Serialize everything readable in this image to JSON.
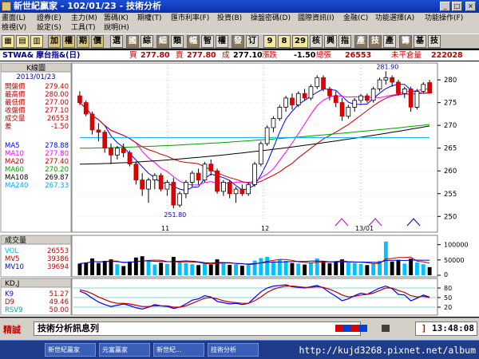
{
  "window": {
    "title": "新世紀贏家 - 102/01/23 - 技術分析"
  },
  "menu": {
    "row1": [
      "畫面(L)",
      "證券(E)",
      "主力(M)",
      "籌碼(K)",
      "期權(T)",
      "匯市利率(F)",
      "投資(B)",
      "操盤密碼(D)",
      "國際資訊(I)",
      "金融(C)",
      "功能選擇(A)",
      "功能操作(F)"
    ],
    "row2": [
      "檢視(V)",
      "設定(S)",
      "工具(T)",
      "說明(H)"
    ]
  },
  "toolbar": {
    "buttons": [
      "加",
      "權",
      "期",
      "價",
      "選",
      "國",
      "綜",
      "細",
      "類",
      "幅",
      "智",
      "權",
      "發",
      "订",
      "9",
      "8",
      "29",
      "核",
      "興",
      "指",
      "產",
      "技",
      "產",
      "籌",
      "基",
      "技"
    ]
  },
  "quote": {
    "symbol": "STWA& 摩台指&(日)",
    "buy_label": "買",
    "buy": "277.80",
    "sell_label": "賣",
    "sell": "277.80",
    "deal_label": "成",
    "deal": "277.10",
    "change_label": "漲跌",
    "change": "-1.50",
    "volume_label": "總張",
    "volume": "26553",
    "oi_label": "未平倉量",
    "oi": "222028"
  },
  "legend_panel": {
    "header": "K線圖",
    "date": "2013/01/23",
    "ohlc": [
      {
        "label": "開盤價",
        "value": "279.40"
      },
      {
        "label": "最高價",
        "value": "280.00"
      },
      {
        "label": "最低價",
        "value": "277.00"
      },
      {
        "label": "收盤價",
        "value": "277.10"
      },
      {
        "label": "成交量",
        "value": "26553"
      },
      {
        "label": "差",
        "value": "-1.50"
      }
    ],
    "ma": [
      {
        "label": "MA5",
        "value": "278.88",
        "color": "#0000ff"
      },
      {
        "label": "MA10",
        "value": "277.80",
        "color": "#ff00ff"
      },
      {
        "label": "MA20",
        "value": "277.40",
        "color": "#c00000"
      },
      {
        "label": "MA60",
        "value": "270.20",
        "color": "#00a000"
      },
      {
        "label": "MA108",
        "value": "269.87",
        "color": "#000000"
      },
      {
        "label": "MA240",
        "value": "267.33",
        "color": "#00aaff"
      }
    ]
  },
  "volume_panel": {
    "header": "成交量",
    "items": [
      {
        "label": "VOL",
        "value": "26553",
        "color": "#00c0ff"
      },
      {
        "label": "MV5",
        "value": "39386",
        "color": "#c00000"
      },
      {
        "label": "MV10",
        "value": "39694",
        "color": "#0000c0"
      }
    ],
    "axis": [
      "100000",
      "50000",
      "0"
    ]
  },
  "kd_panel": {
    "header": "KD,J",
    "items": [
      {
        "label": "K9",
        "value": "51.27",
        "color": "#0000ff"
      },
      {
        "label": "D9",
        "value": "49.46",
        "color": "#c00000"
      },
      {
        "label": "RSV9",
        "value": "50.00",
        "color": "#00a0a0"
      }
    ],
    "axis": [
      "80",
      "50",
      "20"
    ]
  },
  "price_axis": [
    "280",
    "275",
    "270",
    "265",
    "260",
    "255",
    "250"
  ],
  "annotations": {
    "high": "281.90",
    "low": "251.80"
  },
  "date_labels": [
    "11",
    "12",
    "13/01"
  ],
  "status": {
    "badge": "精誠",
    "message": "技術分析訊息列",
    "clock": "13:48:08"
  },
  "taskbar": {
    "tasks": [
      "新世紀贏家",
      "元富贏家",
      "新世紀...",
      "技術分析"
    ],
    "url": "http://kujd3268.pixnet.net/album"
  },
  "chart_data": [
    {
      "type": "candlestick",
      "title": "STWA& 摩台指&(日)",
      "x_ticks": [
        "11",
        "12",
        "13/01"
      ],
      "ylim": [
        249,
        283
      ],
      "annotations": {
        "high": 281.9,
        "low": 251.8
      },
      "candles": [
        [
          276.5,
          277.5,
          274.5,
          275.0
        ],
        [
          275.0,
          275.5,
          272.0,
          272.5
        ],
        [
          272.5,
          273.0,
          268.0,
          269.0
        ],
        [
          269.0,
          270.5,
          266.5,
          268.5
        ],
        [
          268.5,
          269.0,
          264.0,
          265.0
        ],
        [
          265.0,
          266.0,
          261.5,
          263.5
        ],
        [
          263.5,
          265.5,
          262.5,
          265.0
        ],
        [
          265.0,
          266.0,
          263.0,
          264.0
        ],
        [
          264.0,
          264.5,
          261.0,
          261.5
        ],
        [
          261.5,
          262.0,
          257.0,
          258.0
        ],
        [
          258.0,
          259.5,
          254.5,
          256.0
        ],
        [
          256.0,
          258.5,
          253.0,
          258.0
        ],
        [
          258.0,
          259.5,
          256.0,
          259.0
        ],
        [
          259.0,
          259.5,
          255.5,
          256.0
        ],
        [
          256.0,
          258.0,
          254.5,
          257.5
        ],
        [
          257.5,
          258.5,
          251.8,
          252.5
        ],
        [
          252.5,
          255.5,
          252.0,
          255.0
        ],
        [
          255.0,
          258.0,
          254.0,
          257.5
        ],
        [
          257.5,
          260.0,
          256.5,
          259.5
        ],
        [
          259.5,
          260.5,
          257.0,
          258.0
        ],
        [
          258.0,
          262.0,
          257.5,
          261.5
        ],
        [
          261.5,
          262.5,
          259.0,
          260.0
        ],
        [
          260.0,
          260.5,
          255.0,
          255.5
        ],
        [
          255.5,
          258.0,
          254.5,
          257.5
        ],
        [
          257.5,
          258.0,
          254.0,
          255.0
        ],
        [
          255.0,
          256.5,
          253.0,
          256.0
        ],
        [
          256.0,
          257.0,
          254.5,
          255.0
        ],
        [
          255.0,
          257.5,
          254.5,
          257.0
        ],
        [
          257.0,
          262.0,
          256.5,
          261.5
        ],
        [
          261.5,
          266.5,
          261.0,
          266.0
        ],
        [
          266.0,
          270.0,
          265.5,
          269.5
        ],
        [
          269.5,
          272.0,
          268.5,
          271.5
        ],
        [
          271.5,
          274.5,
          271.0,
          274.0
        ],
        [
          274.0,
          276.5,
          273.0,
          276.0
        ],
        [
          276.0,
          277.0,
          273.5,
          274.5
        ],
        [
          274.5,
          277.5,
          274.0,
          277.0
        ],
        [
          277.0,
          278.0,
          275.5,
          276.0
        ],
        [
          276.0,
          279.0,
          275.5,
          278.5
        ],
        [
          278.5,
          281.0,
          278.0,
          280.5
        ],
        [
          280.5,
          281.0,
          277.5,
          278.0
        ],
        [
          278.0,
          278.5,
          275.5,
          276.5
        ],
        [
          276.5,
          277.5,
          274.0,
          275.0
        ],
        [
          275.0,
          276.0,
          271.0,
          272.0
        ],
        [
          272.0,
          274.5,
          271.5,
          274.0
        ],
        [
          274.0,
          276.0,
          273.0,
          275.5
        ],
        [
          275.5,
          277.0,
          274.5,
          276.5
        ],
        [
          276.5,
          277.0,
          275.0,
          275.5
        ],
        [
          275.5,
          278.5,
          275.0,
          278.0
        ],
        [
          278.0,
          280.5,
          277.5,
          280.0
        ],
        [
          280.0,
          281.9,
          279.0,
          280.5
        ],
        [
          280.5,
          281.0,
          278.5,
          279.5
        ],
        [
          279.5,
          280.0,
          276.5,
          277.0
        ],
        [
          277.0,
          278.5,
          276.0,
          278.0
        ],
        [
          278.0,
          278.5,
          273.0,
          274.0
        ],
        [
          274.0,
          278.0,
          273.5,
          277.5
        ],
        [
          277.5,
          279.5,
          277.0,
          279.0
        ],
        [
          279.4,
          280.0,
          277.0,
          277.1
        ]
      ]
    },
    {
      "type": "bar",
      "title": "成交量",
      "ylim": [
        0,
        120000
      ],
      "values": [
        38000,
        42000,
        55000,
        40000,
        47000,
        52000,
        36000,
        30000,
        45000,
        58000,
        62000,
        48000,
        35000,
        41000,
        37000,
        60000,
        44000,
        39000,
        36000,
        33000,
        40000,
        35000,
        52000,
        38000,
        34000,
        36000,
        31000,
        33000,
        48000,
        56000,
        60000,
        45000,
        50000,
        47000,
        40000,
        38000,
        35000,
        42000,
        55000,
        46000,
        39000,
        44000,
        52000,
        41000,
        40000,
        37000,
        33000,
        39000,
        47000,
        110000,
        45000,
        50000,
        38000,
        54000,
        42000,
        36000,
        26553
      ]
    },
    {
      "type": "line",
      "title": "KD,J",
      "ylim": [
        0,
        100
      ],
      "series": [
        {
          "name": "K9",
          "values": [
            70,
            62,
            48,
            36,
            28,
            22,
            26,
            30,
            25,
            18,
            14,
            20,
            28,
            24,
            22,
            16,
            20,
            30,
            42,
            46,
            56,
            52,
            38,
            34,
            30,
            32,
            28,
            32,
            50,
            68,
            80,
            86,
            88,
            90,
            84,
            82,
            80,
            84,
            88,
            80,
            66,
            54,
            40,
            46,
            56,
            64,
            60,
            70,
            80,
            86,
            78,
            60,
            58,
            40,
            48,
            58,
            51.27
          ]
        },
        {
          "name": "D9",
          "values": [
            74,
            70,
            62,
            52,
            44,
            36,
            32,
            32,
            30,
            26,
            22,
            22,
            24,
            24,
            24,
            20,
            20,
            24,
            32,
            40,
            48,
            50,
            46,
            40,
            36,
            34,
            32,
            32,
            40,
            52,
            66,
            76,
            82,
            86,
            86,
            84,
            82,
            82,
            84,
            82,
            76,
            68,
            58,
            52,
            54,
            58,
            60,
            64,
            72,
            80,
            80,
            72,
            66,
            56,
            52,
            54,
            49.46
          ]
        }
      ]
    }
  ]
}
